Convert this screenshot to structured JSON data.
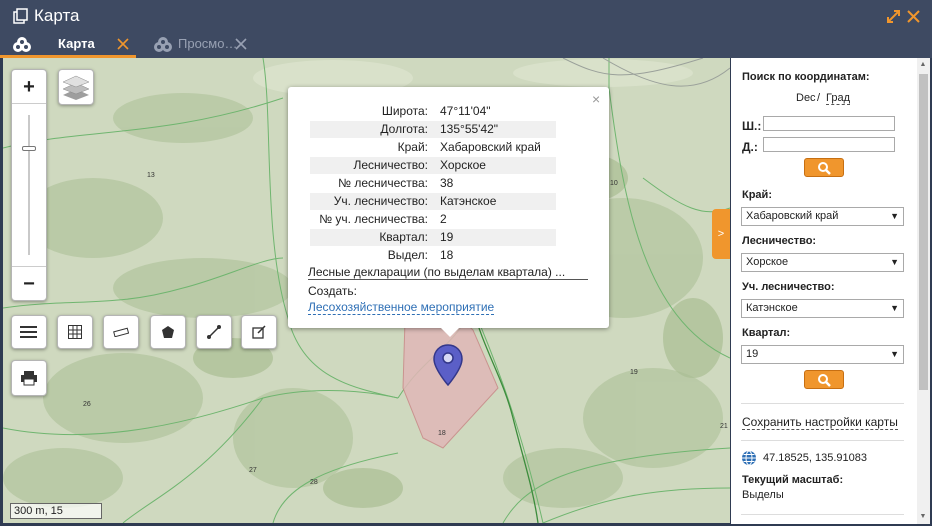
{
  "window": {
    "title": "Карта"
  },
  "tabs": [
    {
      "label": "Карта"
    },
    {
      "label": "Просмо…"
    }
  ],
  "map": {
    "zoom_in": "+",
    "zoom_out": "−",
    "scale": "300 m, 15",
    "labels": [
      "13",
      "10",
      "26",
      "19",
      "18",
      "27",
      "28",
      "21"
    ],
    "toggle_label": ">"
  },
  "popup": {
    "close": "×",
    "rows": [
      {
        "key": "Широта:",
        "value": "47°11'04\""
      },
      {
        "key": "Долгота:",
        "value": "135°55'42\""
      },
      {
        "key": "Край:",
        "value": "Хабаровский край"
      },
      {
        "key": "Лесничество:",
        "value": "Хорское"
      },
      {
        "key": "№ лесничества:",
        "value": "38"
      },
      {
        "key": "Уч. лесничество:",
        "value": "Катэнское"
      },
      {
        "key": "№ уч. лесничества:",
        "value": "2"
      },
      {
        "key": "Квартал:",
        "value": "19"
      },
      {
        "key": "Выдел:",
        "value": "18"
      }
    ],
    "declarations_link": "Лесные декларации (по выделам квартала) ...",
    "create_label": "Создать:",
    "create_link": "Лесохозяйственное мероприятие"
  },
  "panel": {
    "coords_title": "Поиск по координатам:",
    "format_dec": "Dec",
    "format_sep": " / ",
    "format_grad": "Град",
    "lat_label": "Ш.:",
    "lon_label": "Д.:",
    "lat_value": "",
    "lon_value": "",
    "region_label": "Край:",
    "region_value": "Хабаровский край",
    "forestry_label": "Лесничество:",
    "forestry_value": "Хорское",
    "district_label": "Уч. лесничество:",
    "district_value": "Катэнское",
    "quarter_label": "Квартал:",
    "quarter_value": "19",
    "save_settings": "Сохранить настройки карты",
    "cursor_coords": "47.18525, 135.91083",
    "scale_title": "Текущий масштаб:",
    "scale_value": "Выделы"
  },
  "colors": {
    "accent": "#f0962d",
    "titlebar": "#3e4a62",
    "link": "#2e6fb5",
    "marker": "#5b5fc7"
  }
}
